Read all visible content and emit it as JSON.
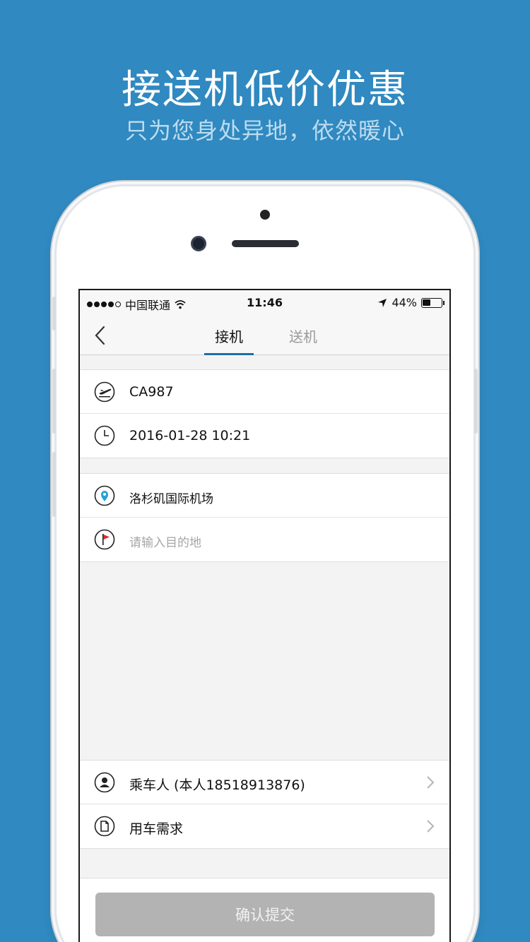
{
  "promo": {
    "title": "接送机低价优惠",
    "subtitle": "只为您身处异地，依然暖心"
  },
  "status_bar": {
    "carrier": "中国联通",
    "time": "11:46",
    "battery": "44%",
    "battery_level": 0.44
  },
  "nav": {
    "tabs": [
      {
        "label": "接机",
        "active": true
      },
      {
        "label": "送机",
        "active": false
      }
    ]
  },
  "flight": {
    "number": "CA987",
    "datetime": "2016-01-28 10:21"
  },
  "route": {
    "origin": "洛杉矶国际机场",
    "destination_placeholder": "请输入目的地"
  },
  "options": {
    "passenger": "乘车人 (本人18518913876)",
    "requirements": "用车需求"
  },
  "submit_label": "确认提交",
  "colors": {
    "background": "#3089c0",
    "tab_indicator": "#1d6ea8",
    "pin_blue": "#2a9fd8",
    "flag_red": "#e02b2b",
    "submit_disabled": "#b3b3b3"
  },
  "icons": {
    "flight": "airplane-icon",
    "time": "clock-icon",
    "origin": "location-pin-icon",
    "destination": "flag-icon",
    "passenger": "person-icon",
    "requirements": "document-icon",
    "back": "chevron-left-icon",
    "row_arrow": "chevron-right-icon"
  }
}
